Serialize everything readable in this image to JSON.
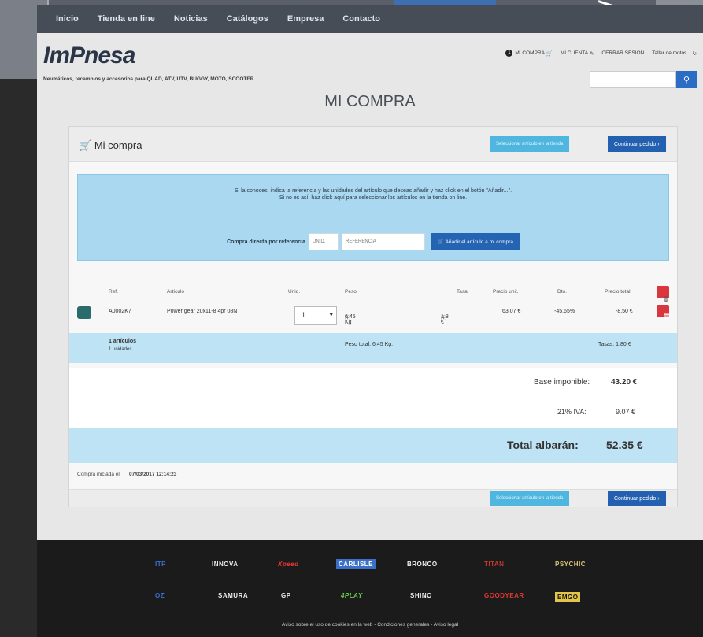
{
  "nav": {
    "items": [
      "Inicio",
      "Tienda en line",
      "Noticias",
      "Catálogos",
      "Empresa",
      "Contacto"
    ]
  },
  "logo": {
    "text": "ImPnesa",
    "tagline": "Neumáticos, recambios y accesorios para QUAD, ATV, UTV, BUGGY, MOTO, SCOOTER"
  },
  "userbar": {
    "badge": "1",
    "cart": "MI COMPRA",
    "account": "MI CUENTA",
    "logout": "CERRAR SESIÓN",
    "user": "Taller de motos..."
  },
  "search": {
    "placeholder": ""
  },
  "page_title": "MI COMPRA",
  "panel": {
    "title": "Mi compra",
    "select_btn": "Seleccionar artículo en la tienda",
    "continue_btn": "Continuar pedido"
  },
  "info": {
    "line1": "Si la conoces, indica la referencia y las unidades del artículo que deseas añadir y haz click en el botón \"Añadir...\".",
    "line2": "Si no es así, haz click aquí para seleccionar los artículos en la tienda on line.",
    "direct_label": "Compra directa por referencia",
    "unid_placeholder": "UNID.",
    "ref_placeholder": "REFERENCIA",
    "add_btn": "Añadir el artículo a mi compra"
  },
  "table": {
    "headers": [
      "Ref.",
      "Artículo",
      "Unid.",
      "Peso",
      "Tasa",
      "Precio unit.",
      "Dto.",
      "Precio total"
    ],
    "row": {
      "ref": "A0002K7",
      "article": "Power gear 20x11-8 4pr 08N",
      "qty": "1",
      "weight": "6.45 Kg",
      "tax": "1.8 €",
      "unit_price": "63.07 €",
      "discount": "-45.65%",
      "total": "-8.50 €"
    },
    "summary": {
      "articles": "1 artículos",
      "units": "1 unidades",
      "weight_total": "Peso total: 6.45 Kg.",
      "taxes": "Tasas: 1.80 €"
    }
  },
  "totals": {
    "base_label": "Base imponible:",
    "base_value": "43.20 €",
    "iva_label": "21% IVA:",
    "iva_value": "9.07 €",
    "total_label": "Total albarán:",
    "total_value": "52.35 €"
  },
  "started": {
    "label": "Compra iniciada el",
    "value": "07/03/2017 12:14:23"
  },
  "brands": [
    "ITP",
    "INNOVA",
    "Xpeed",
    "CARLISLE",
    "BRONCO",
    "TITAN",
    "PSYCHIC",
    "OZ",
    "SAMURA",
    "GP",
    "4PLAY",
    "SHINO",
    "GOODYEAR",
    "EMGO"
  ],
  "legal": "Aviso sobre el uso de cookies en la web  -  Condiciones generales  -  Aviso legal",
  "colors": {
    "accent": "#2360b0",
    "light_accent": "#4fb6e0",
    "danger": "#d9363e",
    "nav": "#474d57"
  }
}
